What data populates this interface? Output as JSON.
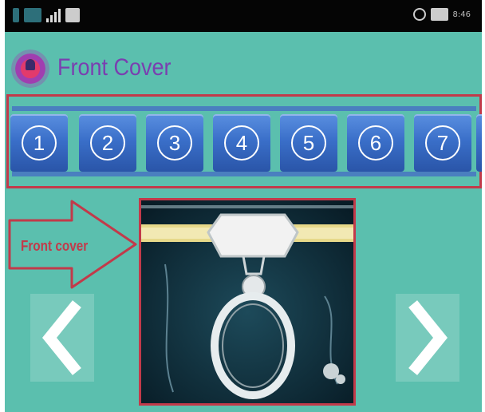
{
  "app_bar": {
    "title": "Front Cover"
  },
  "status_bar": {
    "time": "8:46"
  },
  "page_buttons": [
    "1",
    "2",
    "3",
    "4",
    "5",
    "6",
    "7"
  ],
  "annotation": {
    "label": "Front cover"
  },
  "colors": {
    "background": "#5bbfae",
    "highlight": "#c23a4a",
    "title": "#7a3fb0",
    "button": "#3a6fc9"
  }
}
